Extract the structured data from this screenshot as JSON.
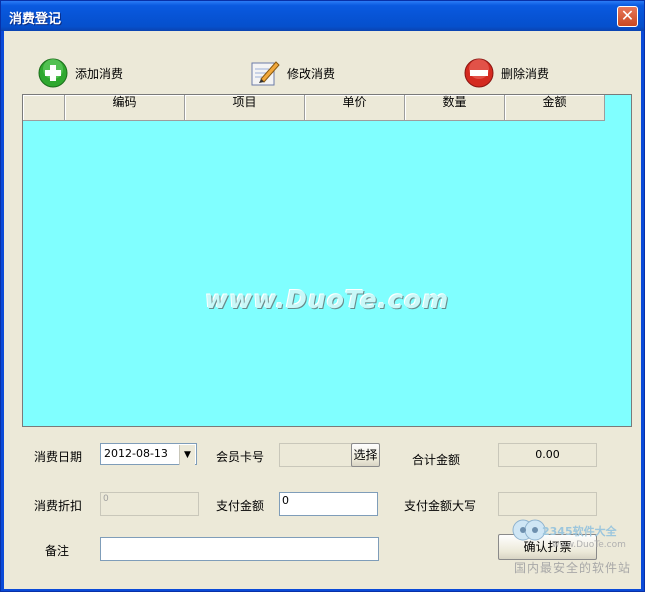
{
  "window": {
    "title": "消费登记",
    "close_glyph": "✕"
  },
  "toolbar": {
    "add_label": "添加消费",
    "edit_label": "修改消费",
    "delete_label": "删除消费",
    "add_icon": "plus-circle-icon",
    "edit_icon": "pencil-note-icon",
    "delete_icon": "minus-circle-icon"
  },
  "table": {
    "columns": [
      "",
      "编码",
      "项目",
      "单价",
      "数量",
      "金额"
    ],
    "rows": [],
    "background": "#80ffff",
    "watermark": "www.DuoTe.com"
  },
  "form": {
    "date_label": "消费日期",
    "date_value": "2012-08-13",
    "card_label": "会员卡号",
    "card_value": "",
    "select_label": "选择",
    "total_label": "合计金额",
    "total_value": "0.00",
    "discount_label": "消费折扣",
    "discount_value": "0",
    "pay_label": "支付金额",
    "pay_value": "0",
    "pay_upper_label": "支付金额大写",
    "pay_upper_value": "",
    "note_label": "备注",
    "note_value": "",
    "confirm_label": "确认打票"
  },
  "overlay": {
    "brand_text": "2345软件大全",
    "brand_url": "www.DuoTe.com",
    "slogan": "国内最安全的软件站"
  }
}
